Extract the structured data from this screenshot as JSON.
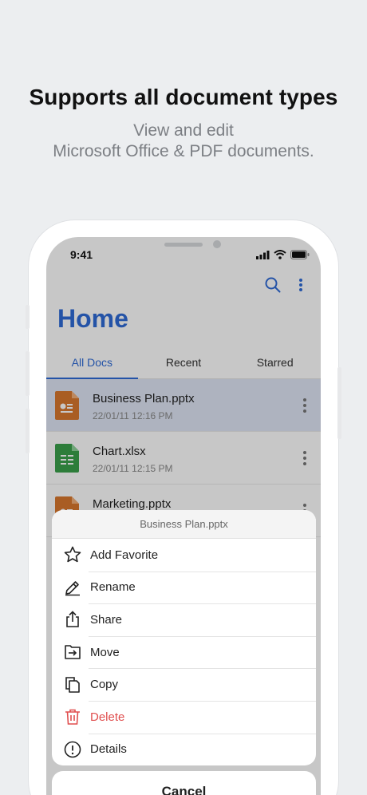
{
  "promo": {
    "headline": "Supports all document types",
    "subline_1": "View and edit",
    "subline_2": "Microsoft Office & PDF documents."
  },
  "status_bar": {
    "time": "9:41"
  },
  "app": {
    "title": "Home",
    "accent_color": "#2f6bd6",
    "tabs": [
      {
        "label": "All Docs",
        "active": true
      },
      {
        "label": "Recent",
        "active": false
      },
      {
        "label": "Starred",
        "active": false
      }
    ],
    "files": [
      {
        "name": "Business Plan.pptx",
        "date": "22/01/11 12:16 PM",
        "type": "pptx",
        "color": "#d9782d",
        "selected": true
      },
      {
        "name": "Chart.xlsx",
        "date": "22/01/11 12:15 PM",
        "type": "xlsx",
        "color": "#3aa14b",
        "selected": false
      },
      {
        "name": "Marketing.pptx",
        "date": "",
        "type": "pptx",
        "color": "#d9782d",
        "selected": false
      }
    ]
  },
  "action_sheet": {
    "title": "Business Plan.pptx",
    "items": [
      {
        "label": "Add Favorite",
        "icon": "star-icon"
      },
      {
        "label": "Rename",
        "icon": "pencil-icon"
      },
      {
        "label": "Share",
        "icon": "share-icon"
      },
      {
        "label": "Move",
        "icon": "move-folder-icon"
      },
      {
        "label": "Copy",
        "icon": "copy-icon"
      },
      {
        "label": "Delete",
        "icon": "trash-icon",
        "danger_color": "#e04e4e"
      },
      {
        "label": "Details",
        "icon": "info-icon"
      }
    ],
    "cancel_label": "Cancel"
  }
}
